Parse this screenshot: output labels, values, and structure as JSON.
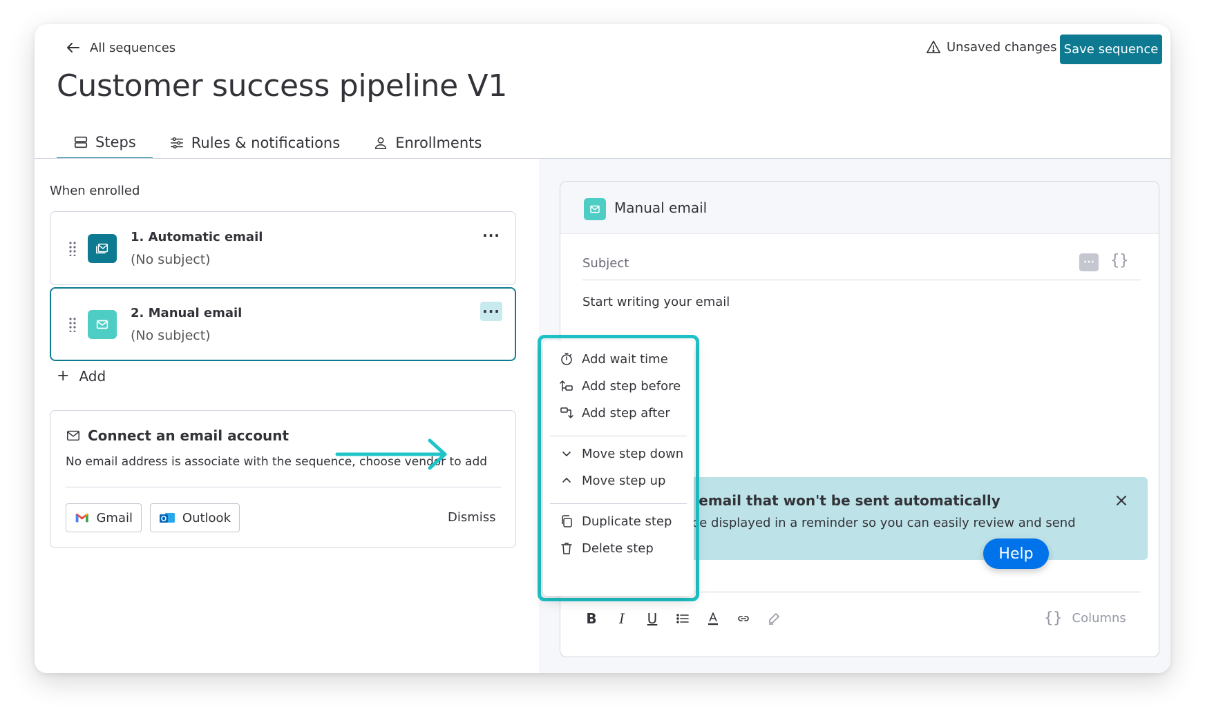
{
  "header": {
    "back_label": "All sequences",
    "title": "Customer success pipeline V1",
    "unsaved_label": "Unsaved changes",
    "save_label": "Save sequence"
  },
  "tabs": [
    {
      "label": "Steps",
      "icon": "steps-icon",
      "active": true
    },
    {
      "label": "Rules & notifications",
      "icon": "sliders-icon",
      "active": false
    },
    {
      "label": "Enrollments",
      "icon": "person-icon",
      "active": false
    }
  ],
  "steps_panel": {
    "when_label": "When enrolled",
    "steps": [
      {
        "title": "1.  Automatic email",
        "subtitle": "(No subject)",
        "icon": "automatic-email-icon",
        "color": "#0d7a91"
      },
      {
        "title": "2.  Manual email",
        "subtitle": "(No subject)",
        "icon": "manual-email-icon",
        "color": "#4ecdc4"
      }
    ],
    "more_glyph": "···",
    "add_label": "Add",
    "connect": {
      "title": "Connect an email account",
      "description": "No email address is associate with the sequence, choose vendor to add",
      "gmail_label": "Gmail",
      "outlook_label": "Outlook",
      "dismiss_label": "Dismiss"
    }
  },
  "editor": {
    "title": "Manual email",
    "subject_placeholder": "Subject",
    "tag_glyph": "···",
    "braces_glyph": "{}",
    "body_placeholder": "Start writing your email",
    "banner_title": "is a manual email that won't be sent automatically",
    "banner_text": "il content will be displayed in a reminder so you can easily review and send",
    "toolbar": {
      "bold": "B",
      "italic": "I",
      "underline": "U"
    },
    "columns_label": "Columns"
  },
  "context_menu": {
    "items": [
      {
        "label": "Add wait time",
        "icon": "stopwatch-icon"
      },
      {
        "label": "Add step before",
        "icon": "insert-before-icon"
      },
      {
        "label": "Add step after",
        "icon": "insert-after-icon"
      },
      {
        "label": "Move step down",
        "icon": "chevron-down-icon"
      },
      {
        "label": "Move step up",
        "icon": "chevron-up-icon"
      },
      {
        "label": "Duplicate step",
        "icon": "duplicate-icon"
      },
      {
        "label": "Delete step",
        "icon": "trash-icon"
      }
    ]
  },
  "help_label": "Help",
  "colors": {
    "accent": "#0d7a91",
    "highlight": "#1ec4c8",
    "banner": "#bde2e8",
    "help": "#0073ea"
  }
}
